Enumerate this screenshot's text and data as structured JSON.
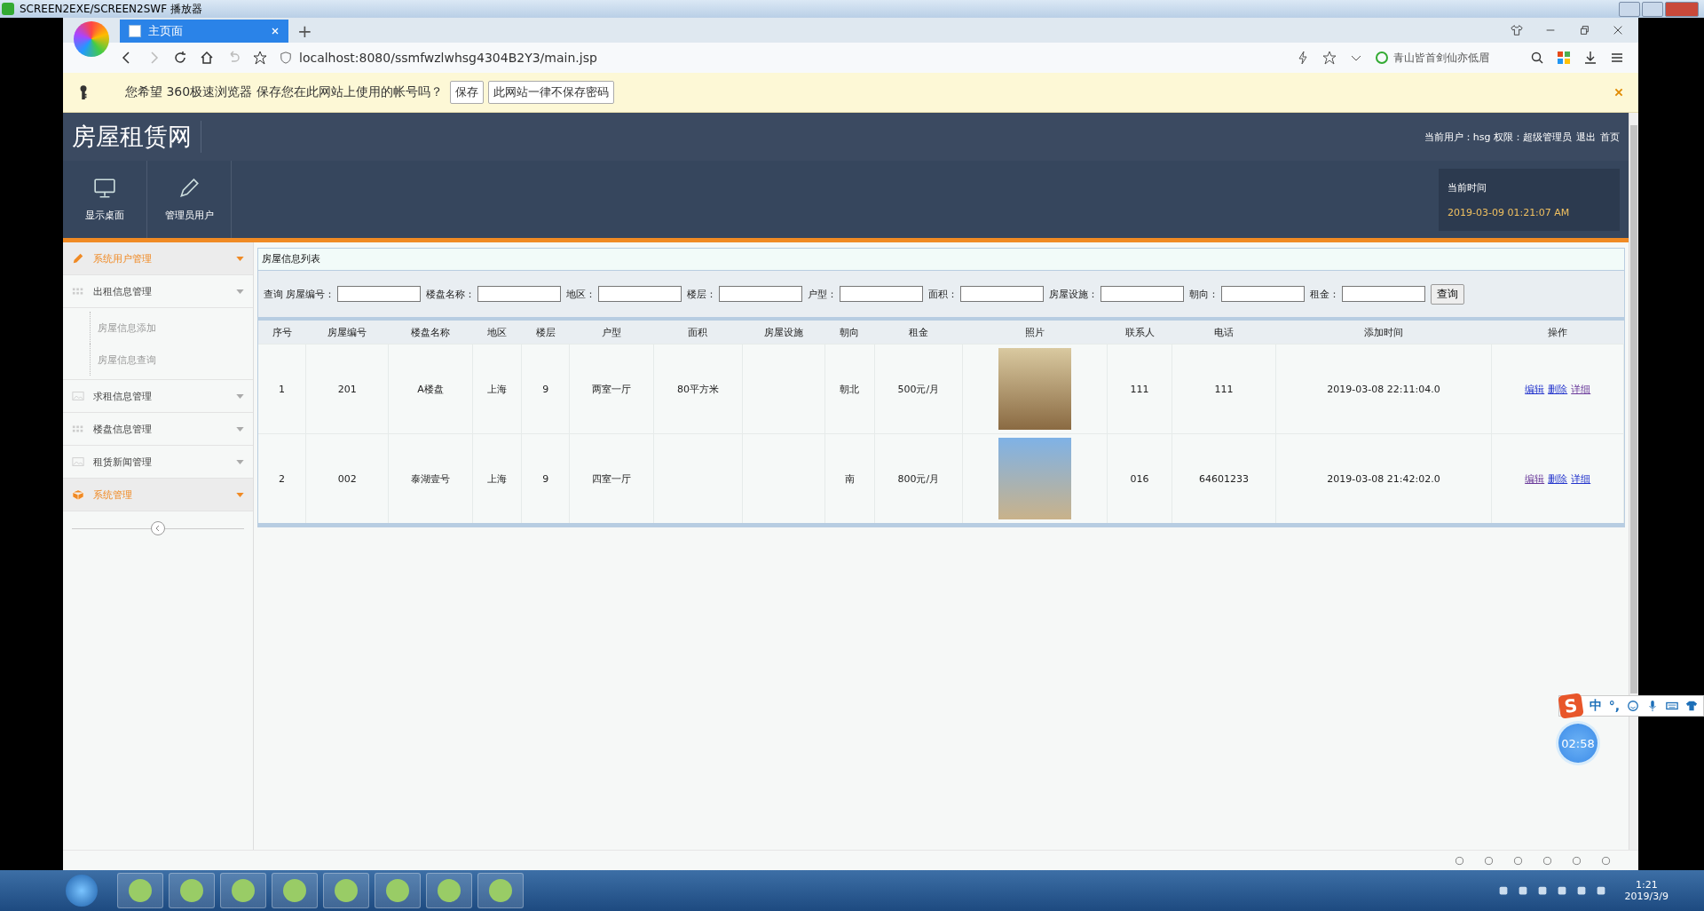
{
  "player": {
    "title": "SCREEN2EXE/SCREEN2SWF 播放器"
  },
  "browser": {
    "tab_title": "主页面",
    "new_tab": "+",
    "url": "localhost:8080/ssmfwzlwhsg4304B2Y3/main.jsp",
    "search_hint": "青山皆首剑仙亦低眉"
  },
  "password_bar": {
    "message": "您希望 360极速浏览器 保存您在此网站上使用的帐号吗？",
    "buttons": [
      "保存",
      "此网站一律不保存密码"
    ]
  },
  "site": {
    "title": "房屋租赁网",
    "user_info": "当前用户：hsg 权限：超级管理员",
    "links": [
      "退出",
      "首页"
    ],
    "nav": [
      {
        "label": "显示桌面"
      },
      {
        "label": "管理员用户"
      }
    ],
    "time_label": "当前时间",
    "time": "2019-03-09 01:21:07 AM"
  },
  "sidebar": {
    "items": [
      {
        "label": "系统用户管理",
        "selected": true
      },
      {
        "label": "出租信息管理",
        "selected": false,
        "children": [
          {
            "label": "房屋信息添加"
          },
          {
            "label": "房屋信息查询"
          }
        ]
      },
      {
        "label": "求租信息管理",
        "selected": false
      },
      {
        "label": "楼盘信息管理",
        "selected": false
      },
      {
        "label": "租赁新闻管理",
        "selected": false
      },
      {
        "label": "系统管理",
        "selected": true
      }
    ]
  },
  "panel": {
    "title": "房屋信息列表",
    "search_prefix": "查询",
    "filters": [
      "房屋编号：",
      "楼盘名称：",
      "地区：",
      "楼层：",
      "户型：",
      "面积：",
      "房屋设施：",
      "朝向：",
      "租金："
    ],
    "search_button": "查询"
  },
  "table": {
    "columns": [
      "序号",
      "房屋编号",
      "楼盘名称",
      "地区",
      "楼层",
      "户型",
      "面积",
      "房屋设施",
      "朝向",
      "租金",
      "照片",
      "联系人",
      "电话",
      "添加时间",
      "操作"
    ],
    "rows": [
      {
        "cells": [
          "1",
          "201",
          "A楼盘",
          "上海",
          "9",
          "两室一厅",
          "80平方米",
          "",
          "朝北",
          "500元/月",
          "",
          "111",
          "111",
          "2019-03-08 22:11:04.0"
        ],
        "actions": [
          {
            "label": "编辑",
            "visited": false
          },
          {
            "label": "删除",
            "visited": false
          },
          {
            "label": "详细",
            "visited": true
          }
        ]
      },
      {
        "cells": [
          "2",
          "002",
          "泰湖壹号",
          "上海",
          "9",
          "四室一厅",
          "",
          "",
          "南",
          "800元/月",
          "",
          "016",
          "64601233",
          "2019-03-08 21:42:02.0"
        ],
        "actions": [
          {
            "label": "编辑",
            "visited": true
          },
          {
            "label": "删除",
            "visited": false
          },
          {
            "label": "详细",
            "visited": false
          }
        ]
      }
    ]
  },
  "ime_bar": {
    "logo": "S",
    "mode": "中",
    "punct": "°,"
  },
  "recorder": {
    "time": "02:58"
  },
  "tray": {
    "time": "1:21",
    "date": "2019/3/9"
  }
}
